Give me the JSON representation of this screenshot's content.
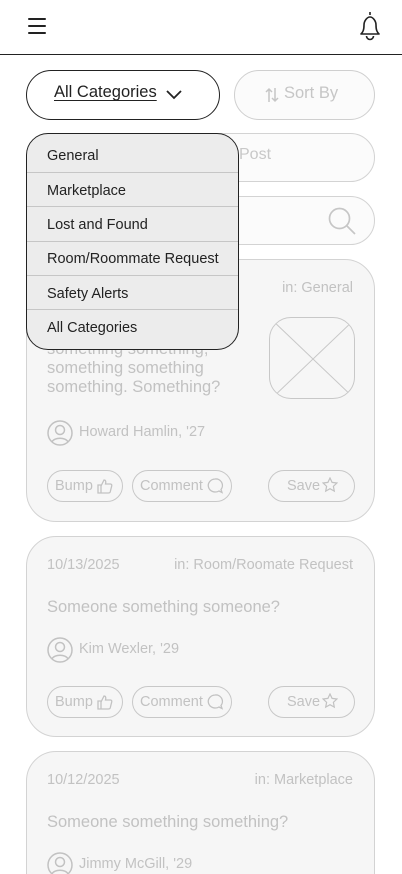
{
  "header": {
    "menu_icon": "hamburger-icon",
    "notification_icon": "bell-icon"
  },
  "filters": {
    "category_label": "All Categories",
    "sort_label": "Sort By",
    "sort_icon": "sort-arrows-icon",
    "chevron_icon": "chevron-down-icon"
  },
  "new_post": {
    "label": "Post"
  },
  "search": {
    "placeholder": "",
    "icon": "search-icon"
  },
  "dropdown": {
    "options": [
      "General",
      "Marketplace",
      "Lost and Found",
      "Room/Roommate Request",
      "Safety Alerts",
      "All Categories"
    ]
  },
  "posts": [
    {
      "category": "in: General",
      "body": "something something,\nsomething something\nsomething. Something?",
      "author": "Howard Hamlin, '27",
      "bump_label": "Bump",
      "comment_label": "Comment",
      "save_label": "Save",
      "image": "image-placeholder"
    },
    {
      "date": "10/13/2025",
      "category": "in: Room/Roomate Request",
      "body": "Someone something someone?",
      "author": "Kim Wexler, '29",
      "bump_label": "Bump",
      "comment_label": "Comment",
      "save_label": "Save"
    },
    {
      "date": "10/12/2025",
      "category": "in: Marketplace",
      "body": "Someone something something?",
      "author": "Jimmy McGill, '29"
    }
  ],
  "colors": {
    "ink": "#222222",
    "muted": "#c2c2c2",
    "card_bg": "#f6f6f6",
    "dropdown_bg": "#ececec"
  }
}
